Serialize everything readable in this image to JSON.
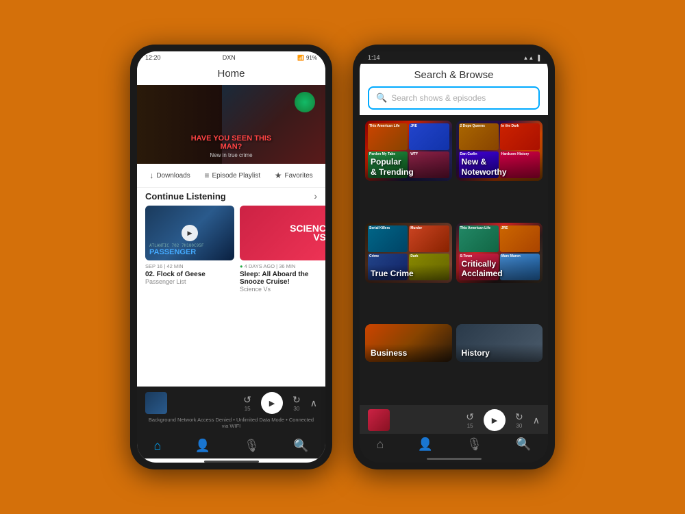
{
  "background_color": "#D4700A",
  "phone1": {
    "status_bar": {
      "time": "12:20",
      "carrier": "DXN",
      "battery": "91%"
    },
    "header": {
      "title": "Home"
    },
    "hero": {
      "main_text": "HAVE YOU SEEN THIS MAN?",
      "sub_text": "New in true crime"
    },
    "actions": [
      {
        "label": "Downloads",
        "icon": "↓"
      },
      {
        "label": "Episode Playlist",
        "icon": "≡"
      },
      {
        "label": "Favorites",
        "icon": "≡+"
      }
    ],
    "continue_listening": {
      "title": "Continue Listening",
      "items": [
        {
          "code": "ATLANTIC 702  7H180C95F",
          "label": "PASSENGER",
          "meta": "SEP 16 | 42 MIN",
          "title": "02. Flock of Geese",
          "show": "Passenger List"
        },
        {
          "label": "SCIENC VS",
          "meta": "4 DAYS AGO | 36 MIN",
          "title": "Sleep: All Aboard the Snooze Cruise!",
          "show": "Science Vs"
        }
      ]
    },
    "player": {
      "skip_back": "15",
      "skip_forward": "30"
    },
    "status_text": "Background Network Access Denied • Unlimited Data Mode • Connected via WIFI",
    "nav_items": [
      {
        "icon": "🏠",
        "active": true
      },
      {
        "icon": "👤",
        "active": false
      },
      {
        "icon": "🎙",
        "active": false
      },
      {
        "icon": "🔍",
        "active": false
      }
    ]
  },
  "phone2": {
    "status_bar": {
      "time": "1:14",
      "battery": "●●●"
    },
    "header": {
      "title": "Search & Browse"
    },
    "search_placeholder": "Search shows & episodes",
    "categories": [
      {
        "label": "Popular\n& Trending",
        "bg_class": "cat-bg-popular"
      },
      {
        "label": "New &\nNoteworthy",
        "bg_class": "cat-bg-new"
      },
      {
        "label": "True Crime",
        "bg_class": "cat-bg-crime"
      },
      {
        "label": "Critically\nAcclaimed",
        "bg_class": "cat-bg-acclaimed"
      },
      {
        "label": "Business",
        "bg_class": "cat-bg-business"
      },
      {
        "label": "History",
        "bg_class": "cat-bg-history"
      }
    ],
    "player": {
      "skip_back": "15",
      "skip_forward": "30"
    },
    "nav_items": [
      {
        "icon": "🏠",
        "active": false
      },
      {
        "icon": "👤",
        "active": false
      },
      {
        "icon": "🎙",
        "active": false
      },
      {
        "icon": "🔍",
        "active": true
      }
    ]
  }
}
